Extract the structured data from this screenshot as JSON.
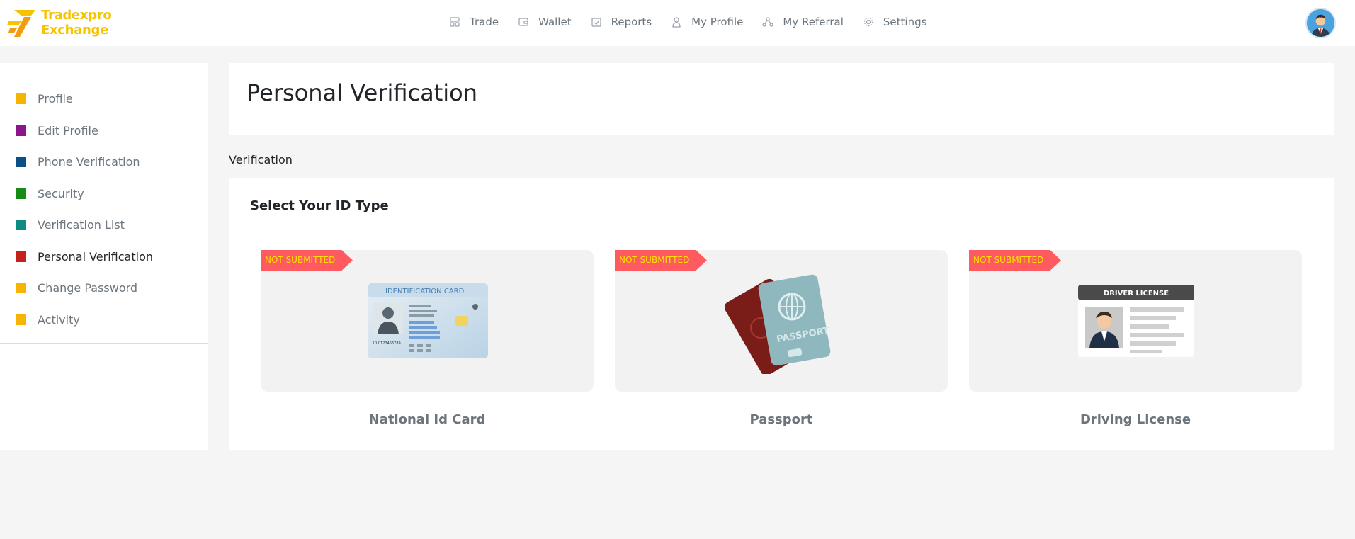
{
  "header": {
    "logo_line1": "Tradexpro",
    "logo_line2": "Exchange",
    "nav": [
      {
        "label": "Trade",
        "icon": "trade-icon"
      },
      {
        "label": "Wallet",
        "icon": "wallet-icon"
      },
      {
        "label": "Reports",
        "icon": "reports-icon"
      },
      {
        "label": "My Profile",
        "icon": "user-icon"
      },
      {
        "label": "My Referral",
        "icon": "referral-icon"
      },
      {
        "label": "Settings",
        "icon": "gear-icon"
      }
    ]
  },
  "sidebar": {
    "items": [
      {
        "label": "Profile",
        "color": "#f4b400"
      },
      {
        "label": "Edit Profile",
        "color": "#8b168b"
      },
      {
        "label": "Phone Verification",
        "color": "#0b4f85"
      },
      {
        "label": "Security",
        "color": "#178a17"
      },
      {
        "label": "Verification List",
        "color": "#0e8a82"
      },
      {
        "label": "Personal Verification",
        "color": "#c4221a"
      },
      {
        "label": "Change Password",
        "color": "#f4b400"
      },
      {
        "label": "Activity",
        "color": "#f4b400"
      }
    ],
    "active": "Personal Verification"
  },
  "page": {
    "title": "Personal Verification",
    "breadcrumb": "Verification",
    "section_title": "Select Your ID Type"
  },
  "id_types": [
    {
      "label": "National Id Card",
      "status": "NOT SUBMITTED",
      "card_text": "IDENTIFICATION CARD",
      "card_number": "ID 0123456789"
    },
    {
      "label": "Passport",
      "status": "NOT SUBMITTED",
      "card_text": "PASSPORT"
    },
    {
      "label": "Driving License",
      "status": "NOT SUBMITTED",
      "card_text": "DRIVER LICENSE"
    }
  ],
  "colors": {
    "brand": "#f7c300",
    "ribbon": "#ff5a5f",
    "ribbon_text": "#ffe000"
  }
}
